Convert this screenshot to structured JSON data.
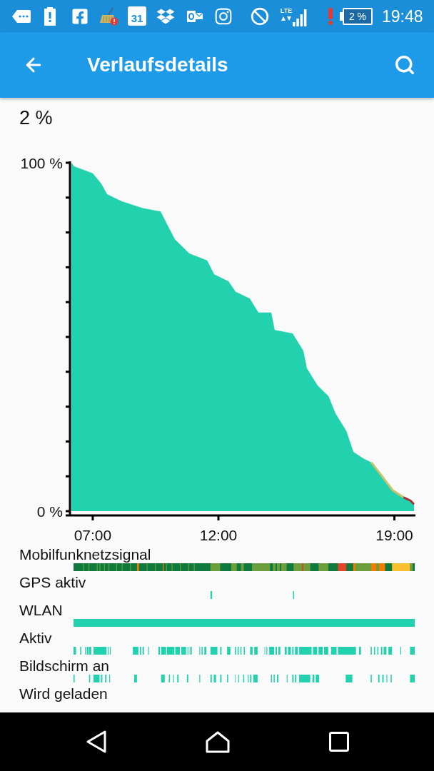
{
  "status_bar": {
    "calendar_day": "31",
    "network_type": "LTE",
    "battery": "2 %",
    "time": "19:48"
  },
  "app_bar": {
    "title": "Verlaufsdetails"
  },
  "current_level": "2 %",
  "chart": {
    "chart_data": {
      "type": "area",
      "x": [
        6.15,
        6.26,
        7.0,
        7.34,
        7.57,
        8.14,
        8.99,
        9.7,
        9.98,
        10.27,
        10.84,
        11.55,
        11.83,
        12.4,
        12.68,
        13.25,
        13.59,
        14.1,
        14.24,
        14.95,
        15.38,
        15.52,
        15.95,
        16.38,
        16.66,
        17.09,
        17.37,
        17.8,
        18.08,
        18.51,
        18.93,
        19.36,
        19.64,
        19.78
      ],
      "series": [
        {
          "color": "#22d1ae",
          "values": [
            100,
            99,
            97,
            94,
            91,
            89,
            87,
            86,
            82,
            78,
            74,
            72,
            68,
            66,
            63,
            61,
            57,
            57,
            52,
            51,
            46,
            41,
            36,
            33,
            28,
            23,
            17,
            15,
            14,
            10,
            6,
            4,
            3,
            2
          ]
        }
      ],
      "xlim": [
        6.15,
        19.78
      ],
      "ylim": [
        0,
        100
      ],
      "xticks": [
        {
          "value": 7,
          "label": "07:00"
        },
        {
          "value": 12,
          "label": "12:00"
        },
        {
          "value": 19,
          "label": "19:00"
        }
      ],
      "yticks": [
        {
          "value": 0,
          "label": "0 %"
        },
        {
          "value": 100,
          "label": "100 %"
        }
      ]
    }
  },
  "timelines": [
    {
      "label": "Mobilfunknetzsignal",
      "kind": "signal"
    },
    {
      "label": "GPS aktiv",
      "kind": "gps"
    },
    {
      "label": "WLAN",
      "kind": "wlan"
    },
    {
      "label": "Aktiv",
      "kind": "awake"
    },
    {
      "label": "Bildschirm an",
      "kind": "screen"
    },
    {
      "label": "Wird geladen",
      "kind": "charging"
    }
  ]
}
